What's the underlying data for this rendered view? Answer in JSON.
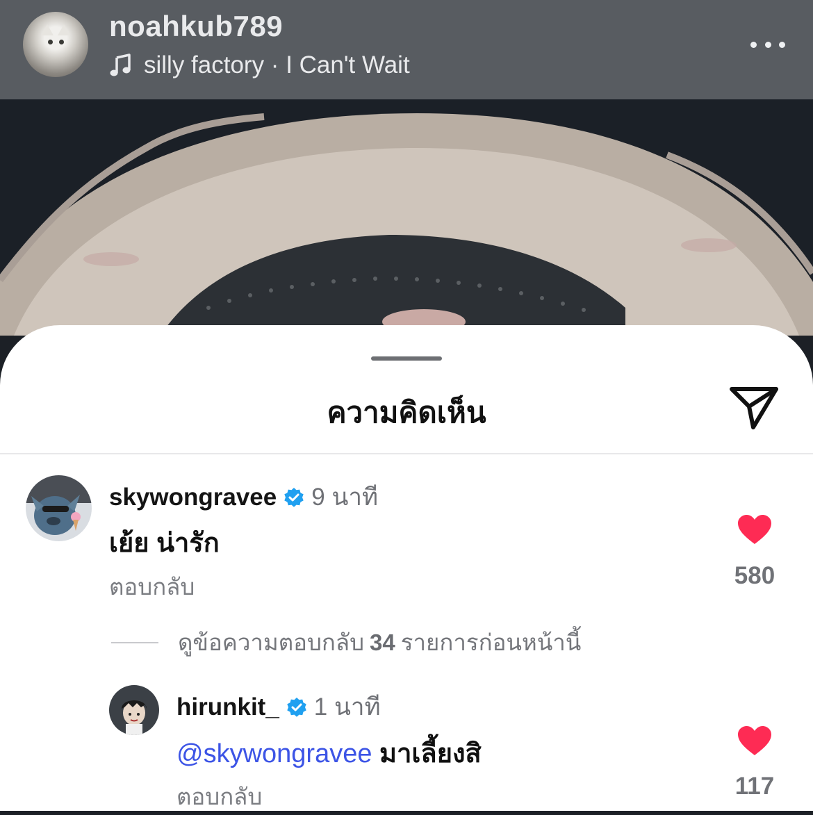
{
  "header": {
    "author": "noahkub789",
    "music": "silly factory · I Can't Wait",
    "avatar_icon": "cat-photo-avatar",
    "menu_icon": "more-dots-icon"
  },
  "sheet": {
    "title": "ความคิดเห็น",
    "send_icon": "send-icon"
  },
  "comments": [
    {
      "username": "skywongravee",
      "time": "9 นาที",
      "text": "เย้ย น่ารัก",
      "reply_label": "ตอบกลับ",
      "likes": "580",
      "verified": true
    },
    {
      "username": "hirunkit_",
      "time": "1 นาที",
      "mention": "@skywongravee",
      "text": "มาเลี้ยงสิ",
      "reply_label": "ตอบกลับ",
      "likes": "117",
      "verified": true
    }
  ],
  "view_replies": {
    "prefix": "ดูข้อความตอบกลับ",
    "count": "34",
    "suffix": "รายการก่อนหน้านี้"
  },
  "colors": {
    "header_bg": "#585c61",
    "heart": "#fe2b54",
    "verified": "#20a0f0",
    "mention": "#3c54e6"
  }
}
